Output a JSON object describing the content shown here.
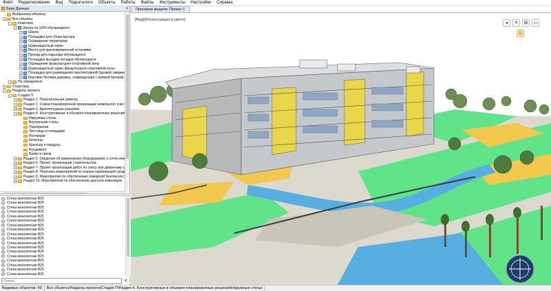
{
  "menu": [
    "Файл",
    "Редактирование",
    "Вид",
    "Подкаталоги",
    "Объекты",
    "Работы",
    "Файлы",
    "Инструменты",
    "Настройки",
    "Справка"
  ],
  "left_pane": {
    "title": "База Данных",
    "tree": [
      {
        "level": 0,
        "exp": "",
        "icon": "folder",
        "label": "Выбранные объекты"
      },
      {
        "level": 0,
        "exp": "-",
        "icon": "folder",
        "label": "Все объекты"
      },
      {
        "level": 1,
        "exp": "-",
        "icon": "folder",
        "label": "Комплекс"
      },
      {
        "level": 2,
        "exp": "-",
        "icon": "item",
        "label": "Школа на 1000 обучающихся"
      },
      {
        "level": 3,
        "exp": "+",
        "icon": "item",
        "label": "Школа"
      },
      {
        "level": 3,
        "exp": "+",
        "icon": "item",
        "label": "Площадка для сбора мусора"
      },
      {
        "level": 3,
        "exp": "+",
        "icon": "item",
        "label": "Ограждение территории"
      },
      {
        "level": 3,
        "exp": "+",
        "icon": "item",
        "label": "Шумозащитный экран"
      },
      {
        "level": 3,
        "exp": "+",
        "icon": "item",
        "label": "Место для кратковременной остановки"
      },
      {
        "level": 3,
        "exp": "+",
        "icon": "item",
        "label": "Проезд для подъезда обучающихся"
      },
      {
        "level": 3,
        "exp": "+",
        "icon": "item",
        "label": "Площадка высадки-посадки обучающихся"
      },
      {
        "level": 3,
        "exp": "+",
        "icon": "item",
        "label": "Ограждение физкультурно-спортивной зоны"
      },
      {
        "level": 3,
        "exp": "+",
        "icon": "item",
        "label": "Шумозащитный экран физкультурно-спортивной зоны"
      },
      {
        "level": 3,
        "exp": "+",
        "icon": "item",
        "label": "Площадка для размещения перспективной буровой скважины"
      },
      {
        "level": 3,
        "exp": "+",
        "icon": "item",
        "label": "Круговая беговая дорожка, совмещенная с прямой беговой дор"
      },
      {
        "level": 1,
        "exp": "+",
        "icon": "folder",
        "label": "Не определено"
      },
      {
        "level": 0,
        "exp": "+",
        "icon": "folder",
        "label": "Структуры"
      },
      {
        "level": 0,
        "exp": "-",
        "icon": "folder",
        "label": "Разделы проекта"
      },
      {
        "level": 1,
        "exp": "-",
        "icon": "folder",
        "label": "Стадия П"
      },
      {
        "level": 2,
        "exp": "+",
        "icon": "folder",
        "label": "Раздел 1. Пояснительная записка"
      },
      {
        "level": 2,
        "exp": "+",
        "icon": "folder",
        "label": "Раздел 2. Схема планировочной организации земельного участ"
      },
      {
        "level": 2,
        "exp": "+",
        "icon": "folder",
        "label": "Раздел 3. Архитектурные решения"
      },
      {
        "level": 2,
        "exp": "-",
        "icon": "folder",
        "label": "Раздел 4. Конструктивные и объемно-планировочные решения"
      },
      {
        "level": 3,
        "exp": "",
        "icon": "folder",
        "label": "Наружные стены"
      },
      {
        "level": 3,
        "exp": "",
        "icon": "folder",
        "label": "Внутренние стены"
      },
      {
        "level": 3,
        "exp": "",
        "icon": "folder",
        "label": "Перекрытия"
      },
      {
        "level": 3,
        "exp": "",
        "icon": "folder",
        "label": "Лестницы и площадки"
      },
      {
        "level": 3,
        "exp": "",
        "icon": "folder",
        "label": "Ростверки"
      },
      {
        "level": 3,
        "exp": "",
        "icon": "folder",
        "label": "Колонны"
      },
      {
        "level": 3,
        "exp": "",
        "icon": "folder",
        "label": "Крыльца и пандусы"
      },
      {
        "level": 3,
        "exp": "",
        "icon": "folder",
        "label": "Фундамент"
      },
      {
        "level": 3,
        "exp": "",
        "icon": "folder",
        "label": "Балки и связи"
      },
      {
        "level": 2,
        "exp": "+",
        "icon": "folder",
        "label": "Раздел 5. Сведения об инженерном оборудовании, о сетях инжен"
      },
      {
        "level": 2,
        "exp": "+",
        "icon": "folder",
        "label": "Раздел 6. Проект организации строительства"
      },
      {
        "level": 2,
        "exp": "+",
        "icon": "folder",
        "label": "Раздел 7. Проект организации работ по сносу или демонтажу об"
      },
      {
        "level": 2,
        "exp": "+",
        "icon": "folder",
        "label": "Раздел 8. Перечень мероприятий по охране окружающей среды"
      },
      {
        "level": 2,
        "exp": "+",
        "icon": "folder",
        "label": "Раздел 9. Мероприятия по обеспечению пожарной безопасности"
      },
      {
        "level": 2,
        "exp": "+",
        "icon": "folder",
        "label": "Раздел 10. Мероприятия по обеспечению доступа инвалидов"
      }
    ],
    "list_item": "Стена монолитная B25",
    "list_count": 18,
    "search_placeholder": "Поиск...",
    "search_clear": "✕"
  },
  "viewport": {
    "tab": "Просмотр модели: Проект 1",
    "view_label": "[Вид]/[Иллюстрация в цвете]",
    "nav_buttons": [
      "◂",
      "✕",
      "⊞",
      "▭"
    ],
    "compass_icon": "compass-icon"
  },
  "status": [
    "Видимых объектов: 49",
    "Все объекты\\Разделы проекта\\Стадия П\\Раздел 4. Конструктивные и объемно-планировочные решения\\Наружные стены\\"
  ]
}
